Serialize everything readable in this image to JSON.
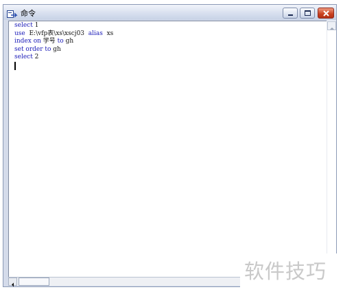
{
  "window": {
    "title": "命令",
    "title_icon": "command-window-icon",
    "buttons": [
      "minimize-icon",
      "maximize-icon",
      "close-icon"
    ]
  },
  "editor": {
    "lines": [
      [
        {
          "t": "select",
          "kw": true
        },
        {
          "t": " 1",
          "kw": false
        }
      ],
      [
        {
          "t": "use",
          "kw": true
        },
        {
          "t": "  E:\\vfp表\\xs\\xscj03  ",
          "kw": false
        },
        {
          "t": "alias",
          "kw": true
        },
        {
          "t": "  xs",
          "kw": false
        }
      ],
      [
        {
          "t": "index on",
          "kw": true
        },
        {
          "t": " 学号 ",
          "kw": false
        },
        {
          "t": "to",
          "kw": true
        },
        {
          "t": " gh",
          "kw": false
        }
      ],
      [
        {
          "t": "set order to",
          "kw": true
        },
        {
          "t": " gh",
          "kw": false
        }
      ],
      [
        {
          "t": "select",
          "kw": true
        },
        {
          "t": " 2",
          "kw": false
        }
      ]
    ]
  },
  "watermark": {
    "text": "软件技巧"
  },
  "colors": {
    "keyword": "#1a1ab8",
    "text": "#111111",
    "titlebar": "#d8e0ef",
    "close_button": "#c9401f"
  }
}
